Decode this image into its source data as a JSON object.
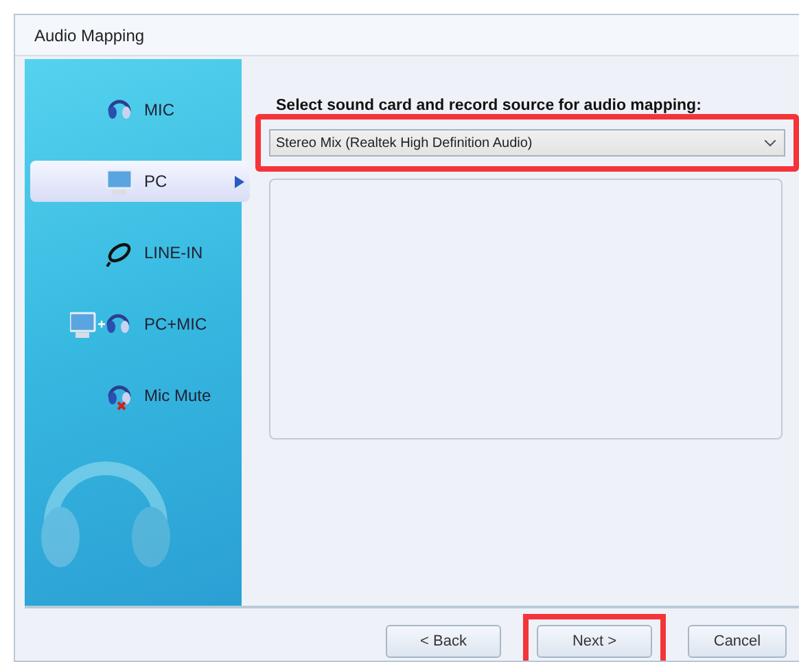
{
  "window": {
    "title": "Audio Mapping"
  },
  "sidebar": {
    "items": [
      {
        "label": "MIC",
        "kind": "mic",
        "selected": false
      },
      {
        "label": "PC",
        "kind": "pc",
        "selected": true
      },
      {
        "label": "LINE-IN",
        "kind": "line",
        "selected": false
      },
      {
        "label": "PC+MIC",
        "kind": "pcmic",
        "selected": false
      },
      {
        "label": "Mic Mute",
        "kind": "mute",
        "selected": false
      }
    ]
  },
  "prompt": "Select sound card and record source for audio mapping:",
  "source_dropdown": {
    "value": "Stereo Mix (Realtek High Definition Audio)",
    "highlighted": true
  },
  "buttons": [
    {
      "label": "< Back",
      "highlighted": false
    },
    {
      "label": "Next >",
      "highlighted": true
    },
    {
      "label": "Cancel",
      "highlighted": false
    }
  ]
}
